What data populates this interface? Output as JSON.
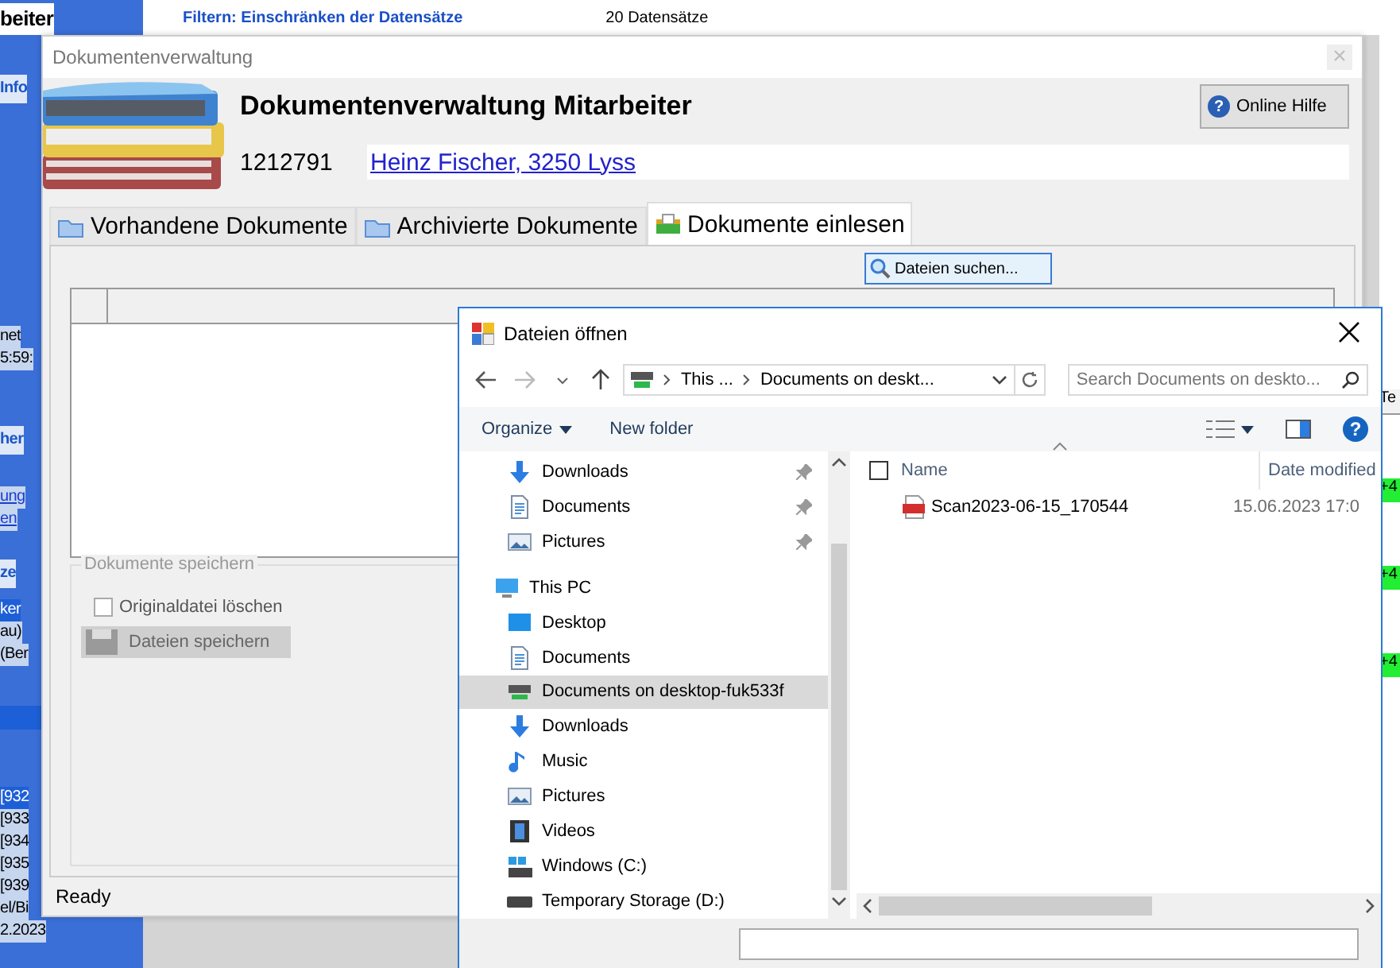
{
  "background_app": {
    "header": {
      "filter_link": "Filtern: Einschränken der Datensätze",
      "count": "20 Datensätze"
    },
    "sidebar": [
      {
        "kind": "title",
        "text": "beiter"
      },
      {
        "kind": "heading",
        "text": "Info"
      },
      {
        "kind": "text",
        "text": "net"
      },
      {
        "kind": "text",
        "text": "5:59:"
      },
      {
        "kind": "heading",
        "text": "her"
      },
      {
        "kind": "link",
        "text": "ung"
      },
      {
        "kind": "link",
        "text": "en"
      },
      {
        "kind": "heading",
        "text": "ze"
      },
      {
        "kind": "selected",
        "text": "ker"
      },
      {
        "kind": "text",
        "text": "au)"
      },
      {
        "kind": "text",
        "text": "(Ber"
      },
      {
        "kind": "band"
      },
      {
        "kind": "selected",
        "text": "[932"
      },
      {
        "kind": "text",
        "text": "[933"
      },
      {
        "kind": "text",
        "text": "[934"
      },
      {
        "kind": "text",
        "text": "[935"
      },
      {
        "kind": "text",
        "text": "[939"
      },
      {
        "kind": "text",
        "text": "el/Bi"
      },
      {
        "kind": "text",
        "text": "2.2023"
      }
    ],
    "right_column": {
      "header": "Te",
      "cells": [
        "+4",
        "+4",
        "+4"
      ]
    }
  },
  "doc_window": {
    "title": "Dokumentenverwaltung",
    "heading": "Dokumentenverwaltung Mitarbeiter",
    "employee_id": "1212791",
    "employee_link": "Heinz Fischer, 3250 Lyss",
    "help_button": "Online Hilfe",
    "help_icon": "?",
    "tabs": [
      {
        "label": "Vorhandene Dokumente",
        "kind": "folder",
        "selected": false
      },
      {
        "label": "Archivierte Dokumente",
        "kind": "folder",
        "selected": false
      },
      {
        "label": "Dokumente einlesen",
        "kind": "inbox",
        "selected": true
      }
    ],
    "search_button": "Dateien suchen...",
    "save_group": {
      "title": "Dokumente speichern",
      "checkbox": {
        "label": "Originaldatei löschen",
        "checked": false
      },
      "save_button": {
        "label": "Dateien speichern",
        "disabled": true
      }
    },
    "status_bar": "Ready"
  },
  "file_dialog": {
    "title": "Dateien öffnen",
    "address": [
      "This ...",
      "Documents on deskt..."
    ],
    "search": {
      "placeholder": "Search Documents on deskto..."
    },
    "toolbar": {
      "organize": "Organize",
      "new_folder": "New folder",
      "help": "?"
    },
    "quick_access": [
      {
        "label": "Downloads",
        "kind": "download",
        "pinned": true,
        "selected": false
      },
      {
        "label": "Documents",
        "kind": "document",
        "pinned": true,
        "selected": false
      },
      {
        "label": "Pictures",
        "kind": "picture",
        "pinned": true,
        "selected": false
      }
    ],
    "this_pc": {
      "label": "This PC",
      "selected": false,
      "children": [
        {
          "label": "Desktop",
          "kind": "desktop",
          "selected": false
        },
        {
          "label": "Documents",
          "kind": "document",
          "selected": false
        },
        {
          "label": "Documents on desktop-fuk533f",
          "kind": "network",
          "selected": true
        },
        {
          "label": "Downloads",
          "kind": "download",
          "selected": false
        },
        {
          "label": "Music",
          "kind": "music",
          "selected": false
        },
        {
          "label": "Pictures",
          "kind": "picture",
          "selected": false
        },
        {
          "label": "Videos",
          "kind": "video",
          "selected": false
        },
        {
          "label": "Windows (C:)",
          "kind": "windrive",
          "selected": false
        },
        {
          "label": "Temporary Storage (D:)",
          "kind": "drive",
          "selected": false
        }
      ]
    },
    "columns": [
      "Name",
      "Date modified"
    ],
    "all_selected": false,
    "files": [
      {
        "name": "Scan2023-06-15_170544",
        "date": "15.06.2023 17:0",
        "selected": false
      }
    ]
  }
}
